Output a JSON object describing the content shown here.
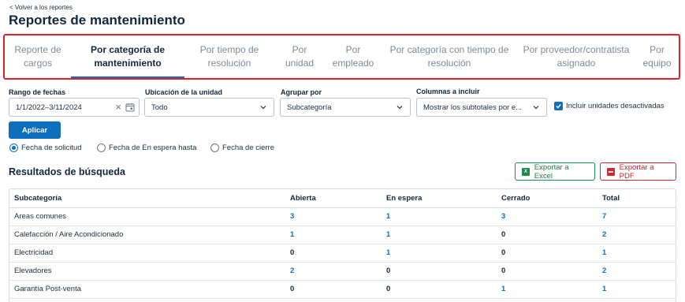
{
  "back_link": "< Volver a los reportes",
  "title": "Reportes de mantenimiento",
  "tabs": [
    {
      "label": "Reporte de\ncargos"
    },
    {
      "label": "Por categoría de\nmantenimiento",
      "active": true
    },
    {
      "label": "Por tiempo de\nresolución"
    },
    {
      "label": "Por\nunidad"
    },
    {
      "label": "Por\nempleado"
    },
    {
      "label": "Por categoría con tiempo de\nresolución"
    },
    {
      "label": "Por proveedor/contratista\nasignado"
    },
    {
      "label": "Por\nequipo"
    }
  ],
  "filters": {
    "date_range": {
      "label": "Rango de fechas",
      "value": "1/1/2022–3/11/2024"
    },
    "unit_location": {
      "label": "Ubicación de la unidad",
      "value": "Todo"
    },
    "group_by": {
      "label": "Agrupar por",
      "value": "Subcategoría"
    },
    "columns": {
      "label": "Columnas a incluir",
      "value": "Mostrar los subtotales por e..."
    },
    "include_inactive": {
      "label": "Incluir unidades desactivadas",
      "checked": true
    }
  },
  "apply_label": "Aplicar",
  "date_type_options": [
    {
      "label": "Fecha de solicitud",
      "selected": true
    },
    {
      "label": "Fecha de En espera hasta",
      "selected": false
    },
    {
      "label": "Fecha de cierre",
      "selected": false
    }
  ],
  "results_title": "Resultados de búsqueda",
  "export_excel_label": "Exportar a Excel",
  "export_pdf_label": "Exportar a PDF",
  "table": {
    "headers": [
      "Subcategoría",
      "Abierta",
      "En espera",
      "Cerrado",
      "Total"
    ],
    "rows": [
      [
        "Areas comunes",
        "3",
        "1",
        "3",
        "7"
      ],
      [
        "Calefacción / Aire Acondicionado",
        "1",
        "1",
        "0",
        "2"
      ],
      [
        "Electricidad",
        "0",
        "1",
        "0",
        "1"
      ],
      [
        "Elevadores",
        "2",
        "0",
        "0",
        "2"
      ],
      [
        "Garantía Post-venta",
        "0",
        "0",
        "1",
        "1"
      ]
    ]
  },
  "colors": {
    "accent": "#0d6fbc",
    "highlight_border": "#e0202a",
    "excel": "#1f8a4c",
    "pdf": "#d0282e"
  }
}
